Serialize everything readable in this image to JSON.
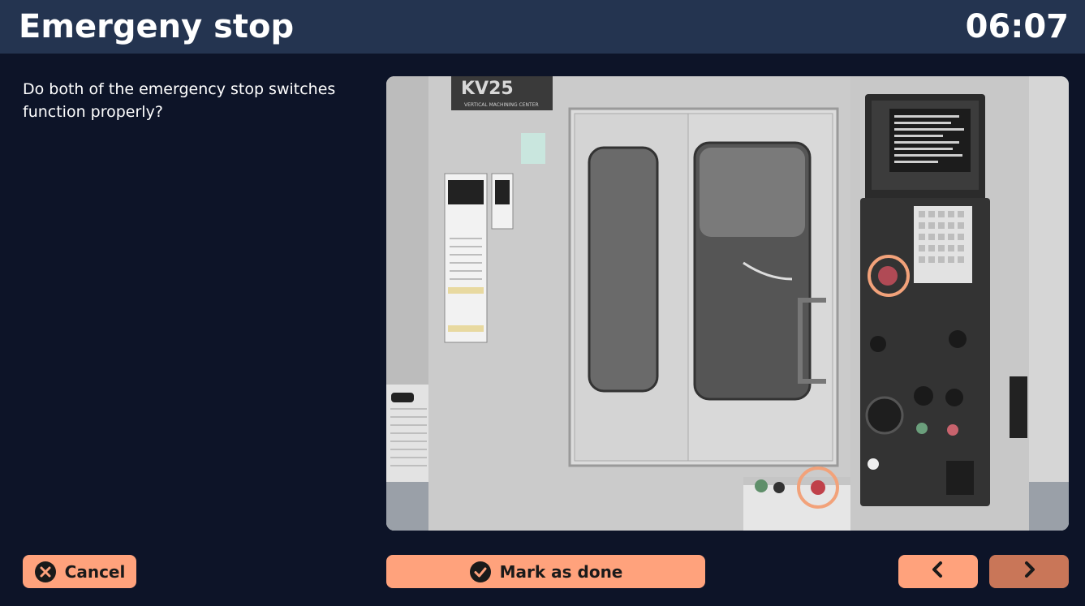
{
  "header": {
    "title": "Emergeny stop",
    "timer": "06:07"
  },
  "question": {
    "text": "Do both of the emergency stop switches function properly?"
  },
  "image": {
    "machine_label": "KV25",
    "machine_sublabel": "VERTICAL MACHINING CENTER",
    "highlight_color": "#f2a27a"
  },
  "buttons": {
    "cancel_label": "Cancel",
    "cancel_icon": "x-circle-icon",
    "done_label": "Mark as done",
    "done_icon": "check-circle-icon",
    "prev_icon": "chevron-left-icon",
    "next_icon": "chevron-right-icon"
  },
  "colors": {
    "header_bg": "#243450",
    "page_bg": "#0d1428",
    "button_bg": "#ffa27c",
    "button_dimmed_bg": "#c97658"
  }
}
